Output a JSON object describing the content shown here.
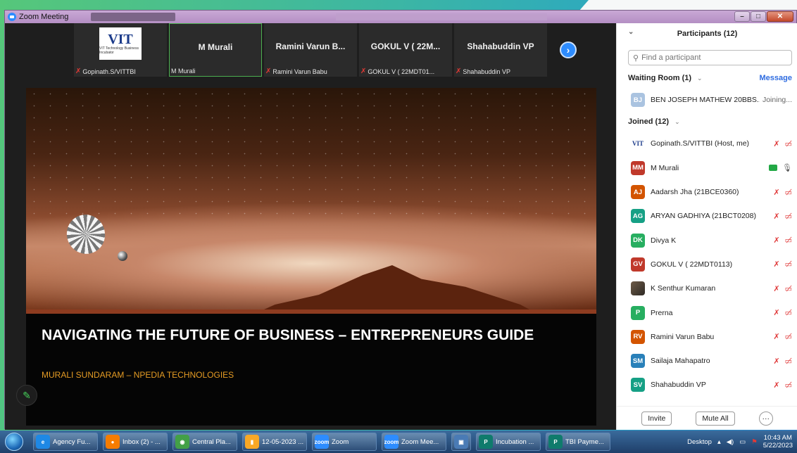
{
  "window": {
    "title": "Zoom Meeting",
    "min_label": "–",
    "max_label": "□",
    "close_label": "✕"
  },
  "strip": {
    "tiles": [
      {
        "name": "",
        "footer": "Gopinath.S/VITTBI",
        "muted": true,
        "logo": "VIT",
        "logo_sub": "VIT Technology Business Incubator"
      },
      {
        "name": "M Murali",
        "footer": "M Murali",
        "muted": false
      },
      {
        "name": "Ramini Varun B...",
        "footer": "Ramini Varun Babu",
        "muted": true
      },
      {
        "name": "GOKUL V ( 22M...",
        "footer": "GOKUL V ( 22MDT01...",
        "muted": true
      },
      {
        "name": "Shahabuddin VP",
        "footer": "Shahabuddin VP",
        "muted": true
      }
    ],
    "next_icon": "›"
  },
  "slide": {
    "title": "NAVIGATING THE FUTURE OF BUSINESS – ENTREPRENEURS GUIDE",
    "subtitle": "MURALI SUNDARAM – NPEDIA TECHNOLOGIES"
  },
  "annotate_icon": "✎",
  "participants": {
    "header": "Participants (12)",
    "search_placeholder": "Find a participant",
    "waiting_label": "Waiting Room (1)",
    "message_label": "Message",
    "waiting": {
      "initials": "BJ",
      "name": "BEN JOSEPH MATHEW 20BBS...",
      "status": "Joining..."
    },
    "joined_label": "Joined (12)",
    "list": [
      {
        "initials": "VIT",
        "color": "#ffffff",
        "name": "Gopinath.S/VITTBI (Host, me)",
        "mic": "muted",
        "video": "off",
        "type": "vit"
      },
      {
        "initials": "MM",
        "color": "#c0392b",
        "name": "M Murali",
        "mic": "on",
        "video": "on"
      },
      {
        "initials": "AJ",
        "color": "#d35400",
        "name": "Aadarsh Jha (21BCE0360)",
        "mic": "muted",
        "video": "off"
      },
      {
        "initials": "AG",
        "color": "#16a085",
        "name": "ARYAN GADHIYA (21BCT0208)",
        "mic": "muted",
        "video": "off"
      },
      {
        "initials": "DK",
        "color": "#27ae60",
        "name": "Divya K",
        "mic": "muted",
        "video": "off"
      },
      {
        "initials": "GV",
        "color": "#c0392b",
        "name": "GOKUL V ( 22MDT0113)",
        "mic": "muted",
        "video": "off"
      },
      {
        "initials": "",
        "color": "#5a4a3a",
        "name": "K Senthur Kumaran",
        "mic": "muted",
        "video": "off",
        "type": "photo"
      },
      {
        "initials": "P",
        "color": "#27ae60",
        "name": "Prerna",
        "mic": "muted",
        "video": "off"
      },
      {
        "initials": "RV",
        "color": "#d35400",
        "name": "Ramini Varun Babu",
        "mic": "muted",
        "video": "off"
      },
      {
        "initials": "SM",
        "color": "#2980b9",
        "name": "Sailaja Mahapatro",
        "mic": "muted",
        "video": "off"
      },
      {
        "initials": "SV",
        "color": "#16a085",
        "name": "Shahabuddin VP",
        "mic": "muted",
        "video": "off"
      }
    ],
    "invite_label": "Invite",
    "mute_all_label": "Mute All",
    "more_label": "···"
  },
  "taskbar": {
    "items": [
      {
        "label": "Agency Fu...",
        "icon": "ie-icon",
        "color": "#1e88e5",
        "glyph": "e"
      },
      {
        "label": "Inbox (2) - ...",
        "icon": "firefox-icon",
        "color": "#f57c00",
        "glyph": "●"
      },
      {
        "label": "Central Pla...",
        "icon": "chrome-icon",
        "color": "#43a047",
        "glyph": "◉"
      },
      {
        "label": "12-05-2023 ...",
        "icon": "folder-icon",
        "color": "#f9a825",
        "glyph": "▮"
      },
      {
        "label": "Zoom",
        "icon": "zoom-icon",
        "color": "#2d8cff",
        "glyph": "zoom"
      },
      {
        "label": "Zoom Mee...",
        "icon": "zoom-icon",
        "color": "#2d8cff",
        "glyph": "zoom"
      },
      {
        "label": "",
        "icon": "network-icon",
        "color": "#4a7bb5",
        "glyph": "▣"
      },
      {
        "label": "Incubation ...",
        "icon": "publisher-icon",
        "color": "#0f7b6c",
        "glyph": "P"
      },
      {
        "label": "TBI Payme...",
        "icon": "publisher-icon",
        "color": "#0f7b6c",
        "glyph": "P"
      }
    ],
    "desktop_label": "Desktop",
    "time": "10:43 AM",
    "date": "5/22/2023"
  }
}
